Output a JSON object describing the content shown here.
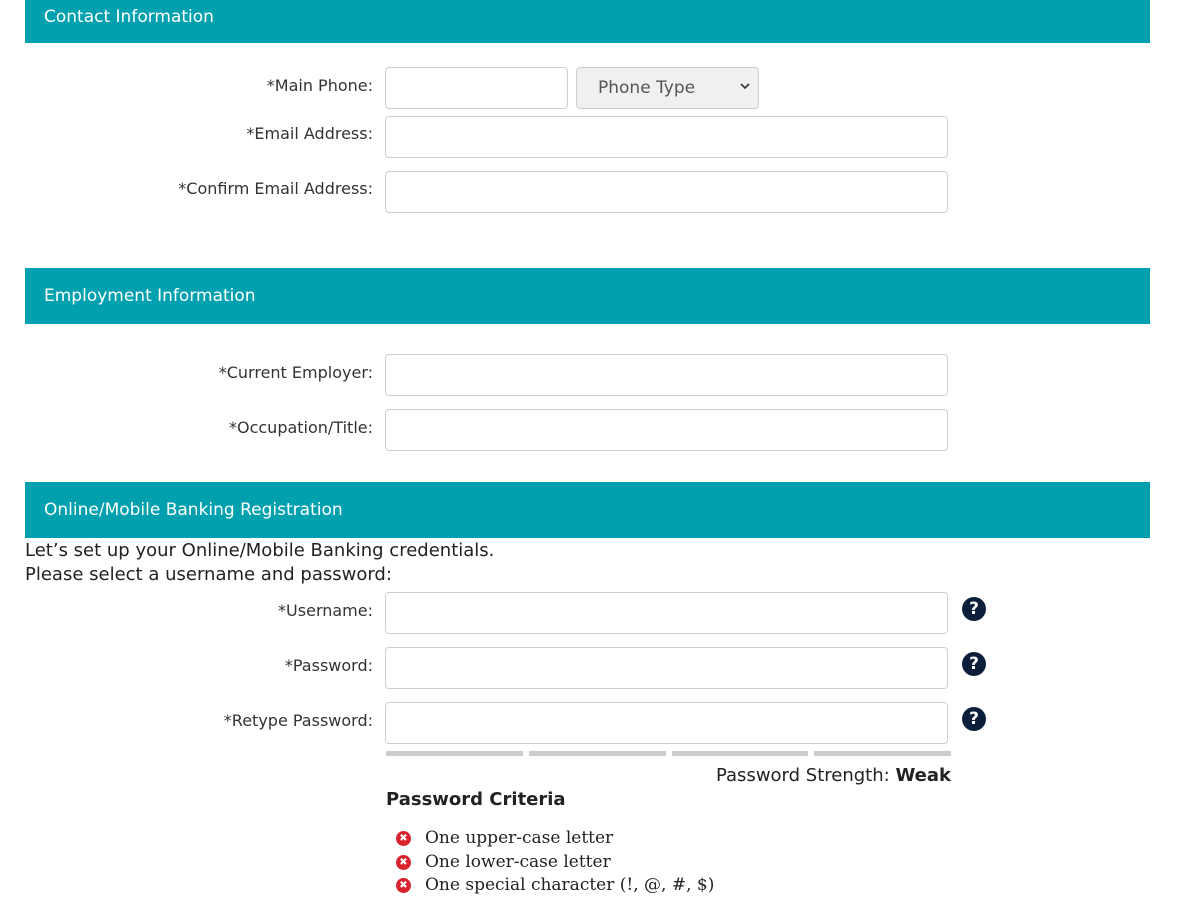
{
  "sections": {
    "contact": "Contact Information",
    "employment": "Employment Information",
    "banking": "Online/Mobile Banking Registration"
  },
  "contact": {
    "main_phone_label": "*Main Phone:",
    "phone_type_placeholder": "Phone Type",
    "email_label": "*Email Address:",
    "confirm_email_label": "*Confirm Email Address:"
  },
  "employment": {
    "employer_label": "*Current Employer:",
    "occupation_label": "*Occupation/Title:"
  },
  "banking": {
    "intro_line1": "Let’s set up your Online/Mobile Banking credentials.",
    "intro_line2": "Please select a username and password:",
    "username_label": "*Username:",
    "password_label": "*Password:",
    "retype_label": "*Retype Password:",
    "help_glyph": "?",
    "strength_label": "Password Strength:",
    "strength_value": "Weak",
    "strength_segments_filled": 0,
    "strength_segments_total": 4,
    "criteria_title": "Password Criteria",
    "criteria": [
      "One upper-case letter",
      "One lower-case letter",
      "One special character (!, @, #, $)"
    ],
    "fail_glyph": "✖"
  },
  "colors": {
    "header_bg": "#00a0ae",
    "help_icon": "#0b1f3a",
    "fail_icon": "#d9232e"
  }
}
